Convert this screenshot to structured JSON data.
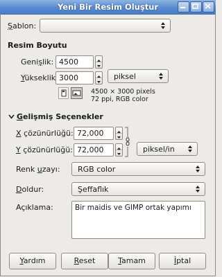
{
  "window": {
    "title": "Yeni Bir Resim Oluştur"
  },
  "template": {
    "label_key": "Ş",
    "label_rest": "ablon:",
    "value": ""
  },
  "image_size": {
    "heading": "Resim Boyutu",
    "width": {
      "label_pre": "Geni",
      "label_key": "ş",
      "label_post": "lik:",
      "value": "4500"
    },
    "height": {
      "label_key": "Y",
      "label_rest": "ükseklik:",
      "value": "3000"
    },
    "unit": "piksel",
    "info_line1": "4500 × 3000 pixels",
    "info_line2": "72 ppi, RGB color"
  },
  "advanced": {
    "heading_key": "G",
    "heading_rest": "elişmiş Seçenekler",
    "x_res": {
      "label_key": "X",
      "label_rest": " çözünürlüğü:",
      "value": "72,000"
    },
    "y_res": {
      "label_key": "Y",
      "label_rest": " çözünürlüğü:",
      "value": "72,000"
    },
    "res_unit": "piksel/in",
    "colorspace": {
      "label_pre": "Renk ",
      "label_key": "u",
      "label_post": "zayı:",
      "value": "RGB color"
    },
    "fill": {
      "label_key": "D",
      "label_rest": "oldur:",
      "value": "Şeffaflık"
    },
    "comment": {
      "label": "Açıklama:",
      "value": "Bir maidis ve GIMP ortak yapımı"
    }
  },
  "buttons": {
    "help": {
      "key": "Y",
      "rest": "ardım"
    },
    "reset": {
      "key": "R",
      "rest": "eset"
    },
    "ok": {
      "key": "T",
      "rest": "amam"
    },
    "cancel": {
      "key": "İ",
      "rest": "ptal"
    }
  },
  "icons": {
    "portrait": "portrait-orientation-icon",
    "landscape": "landscape-orientation-icon",
    "chain": "chain-link-icon"
  },
  "colors": {
    "titlebar": "#5a8bd0",
    "background": "#ecebe7"
  }
}
